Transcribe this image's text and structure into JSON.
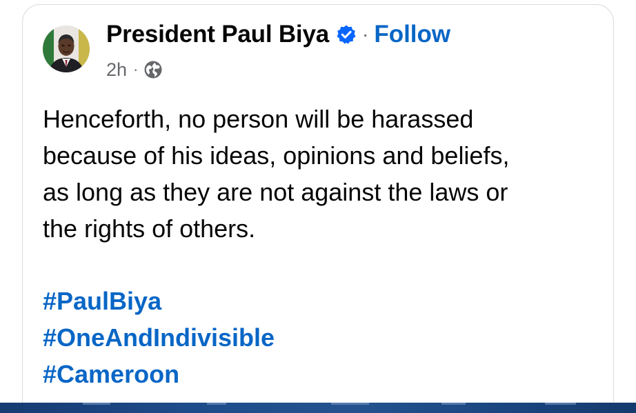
{
  "post": {
    "author": {
      "name": "President Paul Biya",
      "verified_icon": "verified-badge-icon",
      "avatar_icon": "profile-photo"
    },
    "separator": "·",
    "follow_label": "Follow",
    "timestamp": "2h",
    "meta_separator": "·",
    "audience_icon": "globe-icon",
    "text_lines": [
      "Henceforth, no person will be harassed",
      "because of his ideas, opinions and beliefs,",
      "as long as they are not against the laws or",
      "the rights of others."
    ],
    "hashtags": [
      "#PaulBiya",
      "#OneAndIndivisible",
      "#Cameroon"
    ]
  },
  "colors": {
    "text": "#050505",
    "secondary_text": "#65676b",
    "link_blue": "#0866c6",
    "card_border": "#d8dadf",
    "bottom_strip": "#1e4c8a"
  }
}
